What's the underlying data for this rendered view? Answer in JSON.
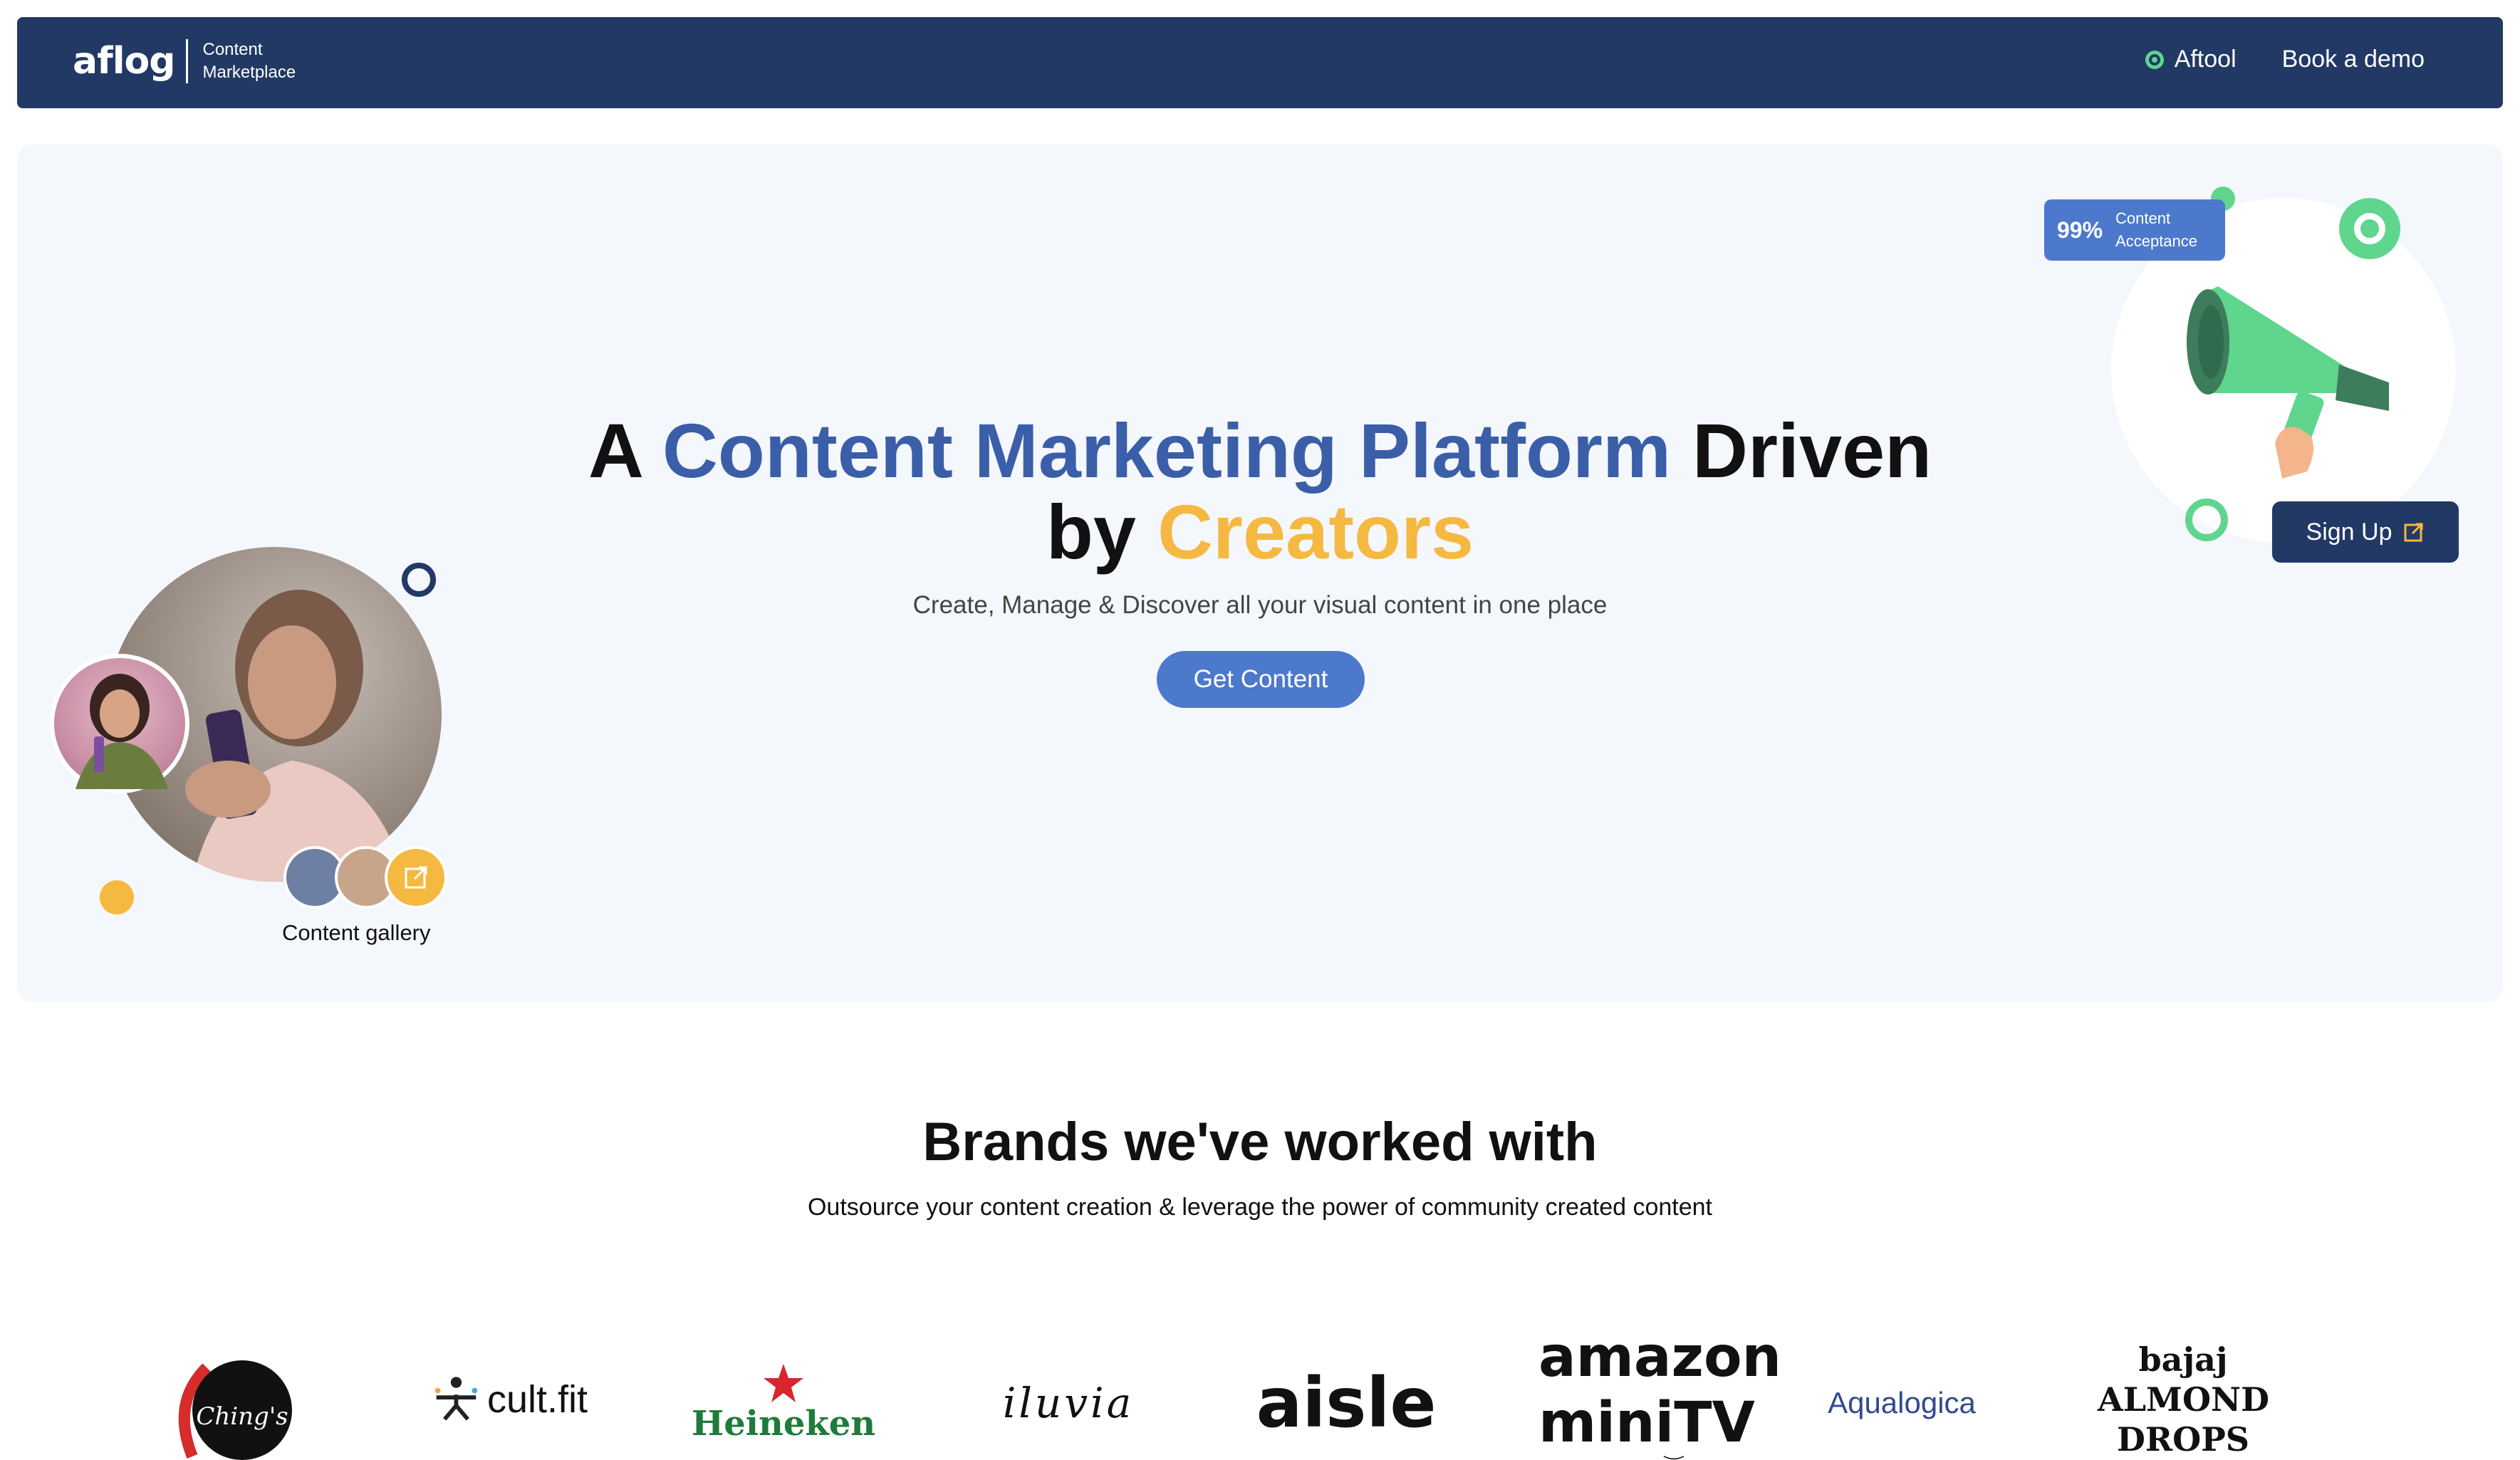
{
  "navbar": {
    "logo_text": "aflog",
    "logo_sub_line1": "Content",
    "logo_sub_line2": "Marketplace",
    "links": [
      {
        "label": "Aftool",
        "icon": "aftool-icon"
      },
      {
        "label": "Book a demo"
      }
    ]
  },
  "hero": {
    "title_a": "A",
    "title_highlight": "Content Marketing Platform",
    "title_driven": "Driven",
    "title_by": "by",
    "title_creators": "Creators",
    "subtitle": "Create, Manage & Discover all your visual content in one place",
    "cta_label": "Get Content",
    "badge_value": "99%",
    "badge_label_line1": "Content",
    "badge_label_line2": "Acceptance",
    "signup_label": "Sign Up",
    "gallery_label": "Content gallery"
  },
  "brands": {
    "title": "Brands we've worked with",
    "subtitle": "Outsource your content creation & leverage the power of community created content",
    "logos": [
      "Ching's",
      "cult.fit",
      "Heineken",
      "iluvia",
      "aisle",
      "amazon miniTV",
      "Aqualogica",
      "bajaj ALMOND DROPS"
    ]
  },
  "colors": {
    "navy": "#223965",
    "accent_blue": "#3b5ea8",
    "button_blue": "#4d79cc",
    "yellow": "#f5b841",
    "green": "#5fd58d",
    "hero_bg": "#f4f7fc"
  }
}
